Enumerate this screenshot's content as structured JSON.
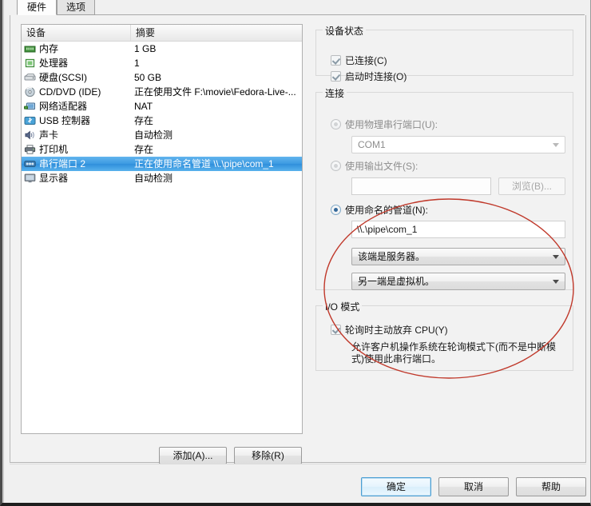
{
  "tabs": [
    {
      "label": "硬件",
      "active": true
    },
    {
      "label": "选项",
      "active": false
    }
  ],
  "device_list": {
    "headers": {
      "device": "设备",
      "summary": "摘要"
    },
    "rows": [
      {
        "icon": "memory-icon",
        "name": "内存",
        "summary": "1 GB"
      },
      {
        "icon": "processor-icon",
        "name": "处理器",
        "summary": "1"
      },
      {
        "icon": "harddisk-icon",
        "name": "硬盘(SCSI)",
        "summary": "50 GB"
      },
      {
        "icon": "cddvd-icon",
        "name": "CD/DVD (IDE)",
        "summary": "正在使用文件 F:\\movie\\Fedora-Live-..."
      },
      {
        "icon": "network-icon",
        "name": "网络适配器",
        "summary": "NAT"
      },
      {
        "icon": "usb-icon",
        "name": "USB 控制器",
        "summary": "存在"
      },
      {
        "icon": "sound-icon",
        "name": "声卡",
        "summary": "自动检测"
      },
      {
        "icon": "printer-icon",
        "name": "打印机",
        "summary": "存在"
      },
      {
        "icon": "serialport-icon",
        "name": "串行端口 2",
        "summary": "正在使用命名管道 \\\\.\\pipe\\com_1",
        "selected": true
      },
      {
        "icon": "display-icon",
        "name": "显示器",
        "summary": "自动检测"
      }
    ],
    "add_button": "添加(A)...",
    "remove_button": "移除(R)"
  },
  "device_status": {
    "title": "设备状态",
    "connected": {
      "label": "已连接(C)",
      "checked": true
    },
    "connect_at_power_on": {
      "label": "启动时连接(O)",
      "checked": true
    }
  },
  "connection": {
    "title": "连接",
    "use_physical_port": {
      "label": "使用物理串行端口(U):",
      "selected": false,
      "enabled": false
    },
    "physical_port_value": "COM1",
    "use_output_file": {
      "label": "使用输出文件(S):",
      "selected": false,
      "enabled": false
    },
    "output_file_value": "",
    "browse_button": "浏览(B)...",
    "use_named_pipe": {
      "label": "使用命名的管道(N):",
      "selected": true,
      "enabled": true
    },
    "pipe_name_value": "\\\\.\\pipe\\com_1",
    "near_end_role": "该端是服务器。",
    "far_end_role": "另一端是虚拟机。"
  },
  "io_mode": {
    "title": "I/O 模式",
    "yield_cpu": {
      "label": "轮询时主动放弃 CPU(Y)",
      "checked": true
    },
    "help_text": "允许客户机操作系统在轮询模式下(而不是中断模式)使用此串行端口。"
  },
  "footer": {
    "ok": "确定",
    "cancel": "取消",
    "help": "帮助"
  },
  "colors": {
    "selection_blue": "#3d9be2",
    "annotation_red": "#c0392b",
    "focus_blue": "#4a9fd4"
  }
}
